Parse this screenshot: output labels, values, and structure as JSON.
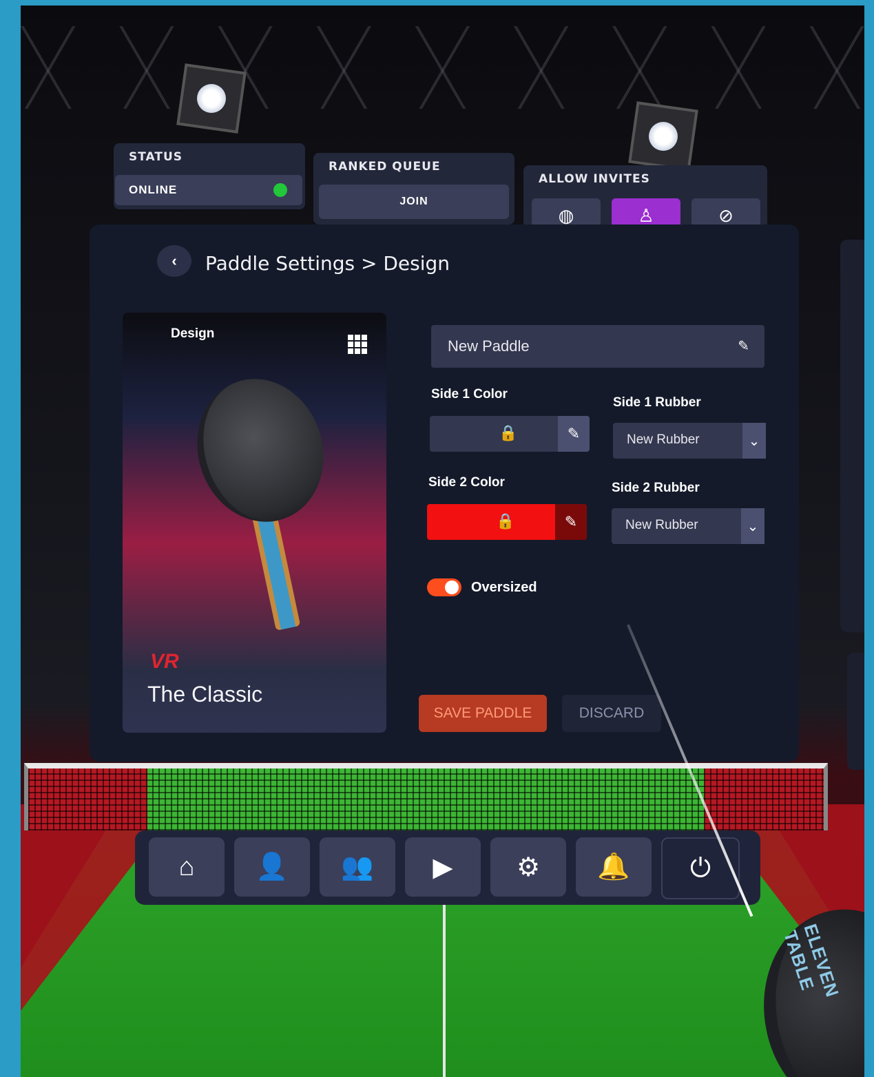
{
  "status": {
    "label": "STATUS",
    "value": "ONLINE",
    "indicator_color": "#22c73a"
  },
  "ranked_queue": {
    "label": "RANKED QUEUE",
    "button": "JOIN"
  },
  "allow_invites": {
    "label": "ALLOW INVITES",
    "options": [
      {
        "icon": "globe-icon",
        "glyph": "◍",
        "active": false
      },
      {
        "icon": "friends-icon",
        "glyph": "♙",
        "active": true
      },
      {
        "icon": "block-icon",
        "glyph": "⊘",
        "active": false
      }
    ],
    "active_color": "#9b2fd0"
  },
  "breadcrumb": {
    "back_glyph": "‹",
    "text": "Paddle Settings > Design"
  },
  "design_card": {
    "label": "Design",
    "brand_mark": "VR",
    "paddle_name": "The Classic"
  },
  "paddle": {
    "name": "New Paddle",
    "side1_color_label": "Side 1 Color",
    "side2_color_label": "Side 2 Color",
    "side1_rubber_label": "Side 1 Rubber",
    "side2_rubber_label": "Side 2 Rubber",
    "side1_rubber": "New Rubber",
    "side2_rubber": "New Rubber",
    "side1_color": "#33374f",
    "side2_color": "#f21010",
    "oversized_label": "Oversized",
    "oversized": true
  },
  "actions": {
    "save": "SAVE PADDLE",
    "discard": "DISCARD"
  },
  "dock": [
    {
      "icon": "home-icon",
      "glyph": "⌂"
    },
    {
      "icon": "profile-icon",
      "glyph": "👤"
    },
    {
      "icon": "friends-icon",
      "glyph": "👥"
    },
    {
      "icon": "replay-icon",
      "glyph": "▶"
    },
    {
      "icon": "settings-icon",
      "glyph": "⚙"
    },
    {
      "icon": "notifications-icon",
      "glyph": "🔔"
    },
    {
      "icon": "power-icon",
      "glyph": "⏻"
    }
  ],
  "held_paddle_text": "ELEVEN TABLE"
}
